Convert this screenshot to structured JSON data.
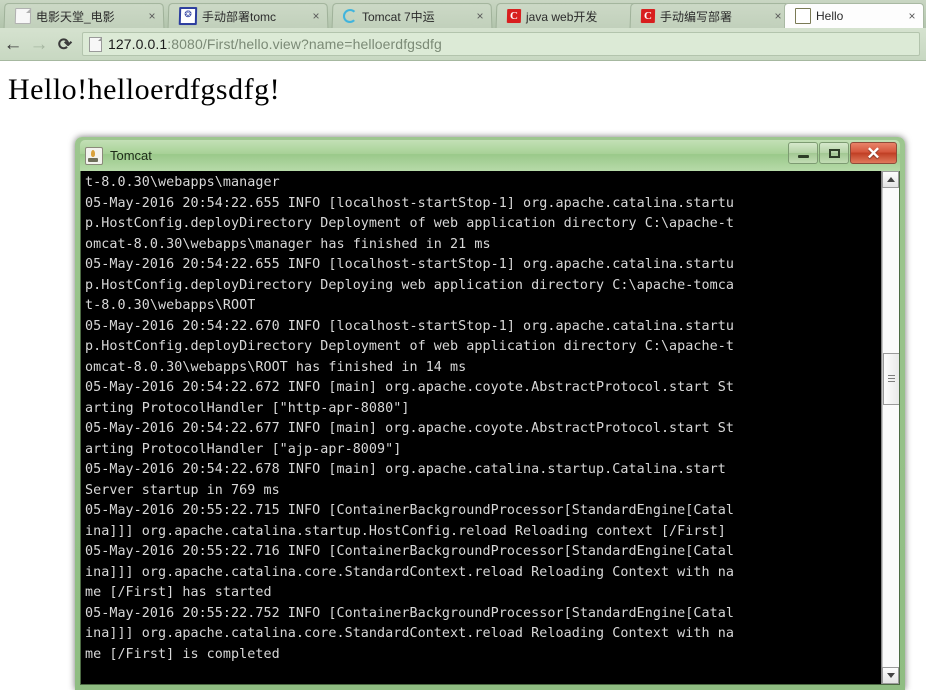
{
  "browser": {
    "tabs": [
      {
        "title": "电影天堂_电影",
        "favicon": "document-icon",
        "active": false,
        "close_label": "×"
      },
      {
        "title": "手动部署tomc",
        "favicon": "blue-paw-icon",
        "active": false,
        "close_label": "×"
      },
      {
        "title": "Tomcat 7中运",
        "favicon": "spinner-icon",
        "active": false,
        "close_label": "×"
      },
      {
        "title": "java web开发",
        "favicon": "csdn-c-icon",
        "active": false,
        "close_label": "×"
      },
      {
        "title": "手动编写部署",
        "favicon": "csdn-c-icon",
        "active": false,
        "close_label": "×"
      },
      {
        "title": "Hello",
        "favicon": "tomcat-icon",
        "active": true,
        "close_label": "×"
      }
    ],
    "toolbar": {
      "back_glyph": "←",
      "forward_glyph": "→",
      "reload_glyph": "⟳",
      "page_icon": "page-icon"
    },
    "omnibox": {
      "host": "127.0.0.1",
      "rest": ":8080/First/hello.view?name=helloerdfgsdfg",
      "full_url": "127.0.0.1:8080/First/hello.view?name=helloerdfgsdfg"
    },
    "page": {
      "heading": "Hello!helloerdfgsdfg!"
    }
  },
  "tomcat_window": {
    "title": "Tomcat",
    "icon": "tomcat-icon",
    "buttons": {
      "minimize": "minimize-button",
      "maximize": "maximize-button",
      "close_label": "✕"
    },
    "console_text": "t-8.0.30\\webapps\\manager\n05-May-2016 20:54:22.655 INFO [localhost-startStop-1] org.apache.catalina.startu\np.HostConfig.deployDirectory Deployment of web application directory C:\\apache-t\nomcat-8.0.30\\webapps\\manager has finished in 21 ms\n05-May-2016 20:54:22.655 INFO [localhost-startStop-1] org.apache.catalina.startu\np.HostConfig.deployDirectory Deploying web application directory C:\\apache-tomca\nt-8.0.30\\webapps\\ROOT\n05-May-2016 20:54:22.670 INFO [localhost-startStop-1] org.apache.catalina.startu\np.HostConfig.deployDirectory Deployment of web application directory C:\\apache-t\nomcat-8.0.30\\webapps\\ROOT has finished in 14 ms\n05-May-2016 20:54:22.672 INFO [main] org.apache.coyote.AbstractProtocol.start St\narting ProtocolHandler [\"http-apr-8080\"]\n05-May-2016 20:54:22.677 INFO [main] org.apache.coyote.AbstractProtocol.start St\narting ProtocolHandler [\"ajp-apr-8009\"]\n05-May-2016 20:54:22.678 INFO [main] org.apache.catalina.startup.Catalina.start\nServer startup in 769 ms\n05-May-2016 20:55:22.715 INFO [ContainerBackgroundProcessor[StandardEngine[Catal\nina]]] org.apache.catalina.startup.HostConfig.reload Reloading context [/First]\n05-May-2016 20:55:22.716 INFO [ContainerBackgroundProcessor[StandardEngine[Catal\nina]]] org.apache.catalina.core.StandardContext.reload Reloading Context with na\nme [/First] has started\n05-May-2016 20:55:22.752 INFO [ContainerBackgroundProcessor[StandardEngine[Catal\nina]]] org.apache.catalina.core.StandardContext.reload Reloading Context with na\nme [/First] is completed",
    "scrollbar": {
      "up_arrow": "scroll-up-arrow",
      "down_arrow": "scroll-down-arrow"
    }
  }
}
